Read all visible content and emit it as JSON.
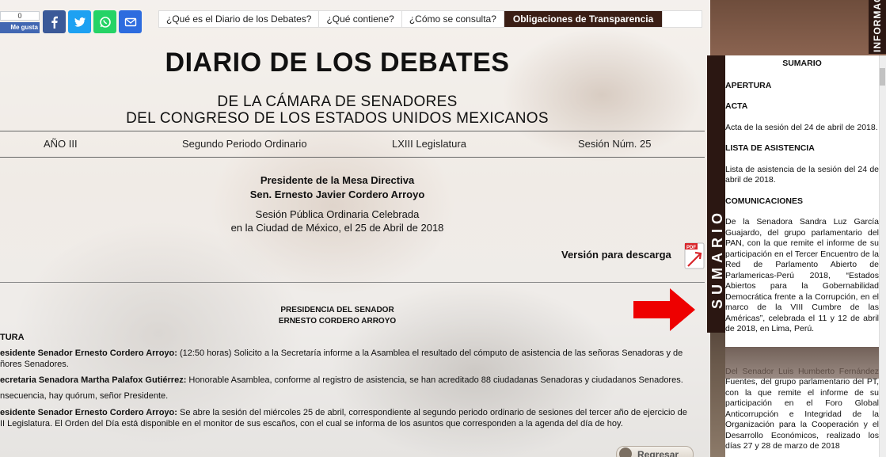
{
  "social": {
    "like_count": "0",
    "like_label": "Me gusta",
    "colors": {
      "facebook": "#3b5998",
      "twitter": "#1da1f2",
      "whatsapp": "#25d366",
      "email": "#2d6cdf"
    }
  },
  "nav": {
    "items": [
      "¿Qué es el Diario de los Debates?",
      "¿Qué contiene?",
      "¿Cómo se consulta?"
    ],
    "active": "Obligaciones de Transparencia"
  },
  "header": {
    "title": "DIARIO DE LOS DEBATES",
    "subtitle1": "DE LA CÁMARA DE SENADORES",
    "subtitle2": "DEL CONGRESO DE LOS ESTADOS UNIDOS MEXICANOS"
  },
  "session_info": {
    "year": "AÑO III",
    "period": "Segundo Periodo Ordinario",
    "legislature": "LXIII Legislatura",
    "session": "Sesión Núm. 25"
  },
  "mesa": {
    "role": "Presidente de la Mesa Directiva",
    "name": "Sen. Ernesto Javier Cordero Arroyo",
    "session_line1": "Sesión Pública Ordinaria Celebrada",
    "session_line2": "en la Ciudad de México, el 25 de Abril de 2018"
  },
  "download": {
    "label": "Versión para descarga",
    "icon": "pdf-icon"
  },
  "presidencia": {
    "line1": "PRESIDENCIA DEL SENADOR",
    "line2": "ERNESTO CORDERO ARROYO"
  },
  "body": {
    "section": "TURA",
    "p1_speaker": "esidente Senador Ernesto Cordero Arroyo:",
    "p1_text": " (12:50 horas) Solicito a la Secretaría informe a la Asamblea el resultado del cómputo de asistencia de las señoras Senadoras y de",
    "p1_cont": "ñores Senadores.",
    "p2_speaker": "ecretaria Senadora Martha Palafox Gutiérrez:",
    "p2_text": " Honorable Asamblea, conforme al registro de asistencia, se han acreditado 88 ciudadanas Senadoras y ciudadanos Senadores.",
    "p3_text": "nsecuencia, hay quórum, señor Presidente.",
    "p4_speaker": "esidente Senador Ernesto Cordero Arroyo:",
    "p4_text": " Se abre la sesión del miércoles 25 de abril, correspondiente al segundo periodo ordinario de sesiones del tercer año de ejercicio de",
    "p4_cont": "II Legislatura. El Orden del Día está disponible en el monitor de sus escaños, con el cual se informa de los asuntos que corresponden a la agenda del día de hoy."
  },
  "regresar": "Regresar",
  "side_tabs": {
    "info": "INFORMAC",
    "sumario": "SUMARIO"
  },
  "sumario": {
    "title": "SUMARIO",
    "apertura": "APERTURA",
    "acta": "ACTA",
    "acta_text": "Acta de la sesión del 24 de abril de 2018.",
    "lista": "LISTA DE ASISTENCIA",
    "lista_text": "Lista de asistencia de la sesión del 24 de abril de 2018.",
    "comunicaciones": "COMUNICACIONES",
    "com1": "De la Senadora Sandra Luz García Guajardo, del grupo parlamentario del PAN, con la que remite el informe de su participación en el Tercer Encuentro de la Red de Parlamento Abierto de Parlamericas-Perú 2018, “Estados Abiertos para la Gobernabilidad Democrática frente a la Corrupción, en el marco de la VIII Cumbre de las Américas”, celebrada el 11 y 12 de abril de 2018, en Lima, Perú.",
    "com2": "Del Senador Luis Humberto Fernández Fuentes, del grupo parlamentario del PT, con la que remite el informe de su participación en el Foro Global Anticorrupción e Integridad de la Organización para la Cooperación y el Desarrollo Económicos, realizado los días 27 y 28 de marzo de 2018"
  }
}
